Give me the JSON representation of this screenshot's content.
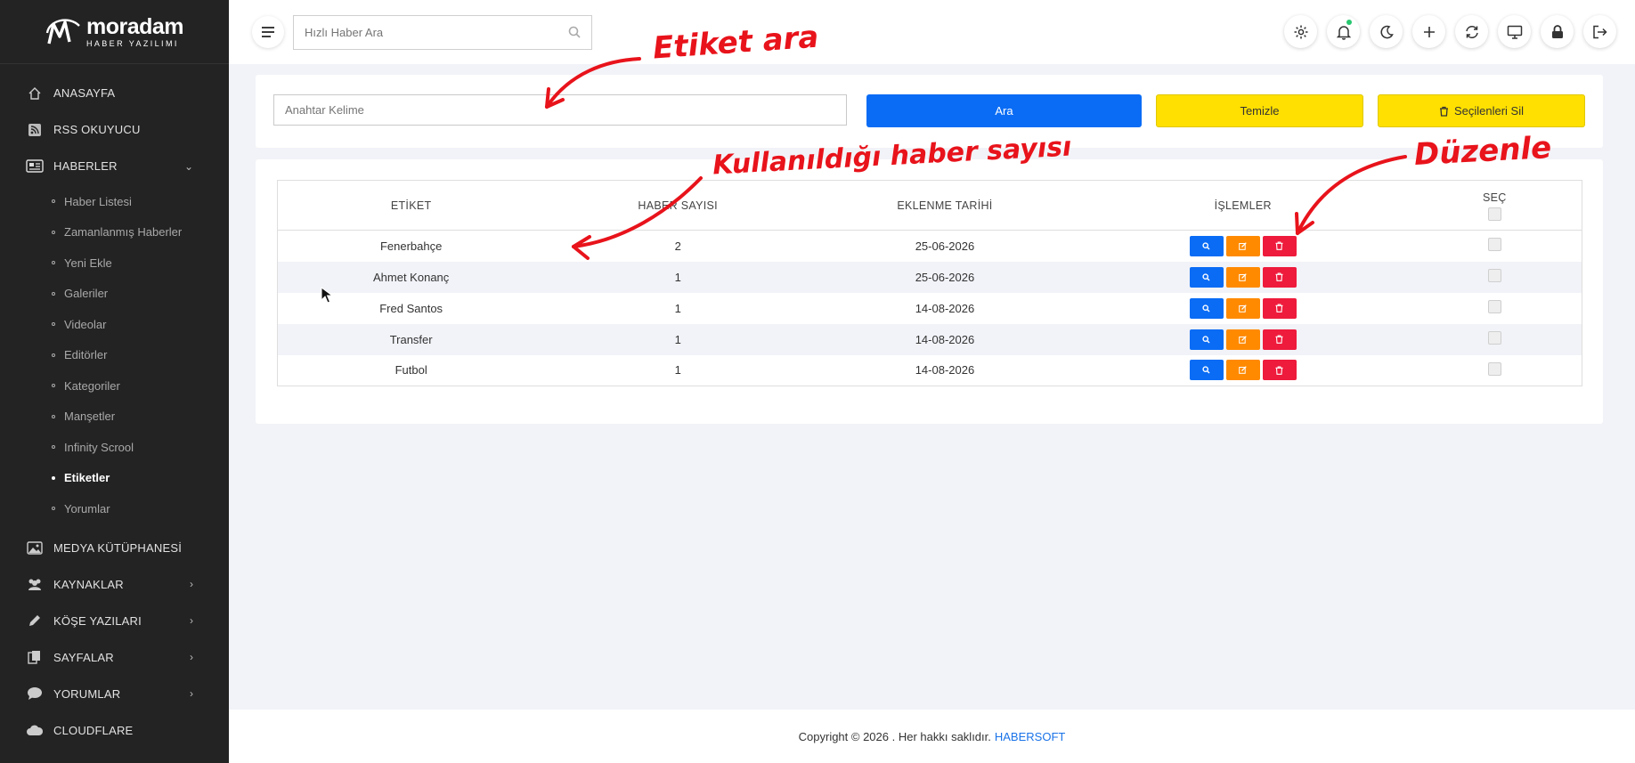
{
  "brand": {
    "name": "moradam",
    "subtitle": "HABER YAZILIMI"
  },
  "sidebar": {
    "items": [
      {
        "label": "ANASAYFA",
        "icon": "home-icon",
        "chevron": false
      },
      {
        "label": "RSS OKUYUCU",
        "icon": "rss-icon",
        "chevron": false
      },
      {
        "label": "HABERLER",
        "icon": "newspaper-icon",
        "chevron": "down",
        "children": [
          {
            "label": "Haber Listesi"
          },
          {
            "label": "Zamanlanmış Haberler"
          },
          {
            "label": "Yeni Ekle"
          },
          {
            "label": "Galeriler"
          },
          {
            "label": "Videolar"
          },
          {
            "label": "Editörler"
          },
          {
            "label": "Kategoriler"
          },
          {
            "label": "Manşetler"
          },
          {
            "label": "Infinity Scrool"
          },
          {
            "label": "Etiketler",
            "active": true
          },
          {
            "label": "Yorumlar"
          }
        ]
      },
      {
        "label": "MEDYA KÜTÜPHANESİ",
        "icon": "image-icon",
        "chevron": false
      },
      {
        "label": "KAYNAKLAR",
        "icon": "users-icon",
        "chevron": "right"
      },
      {
        "label": "KÖŞE YAZILARI",
        "icon": "pen-icon",
        "chevron": "right"
      },
      {
        "label": "SAYFALAR",
        "icon": "pages-icon",
        "chevron": "right"
      },
      {
        "label": "YORUMLAR",
        "icon": "comment-icon",
        "chevron": "right"
      },
      {
        "label": "CLOUDFLARE",
        "icon": "cloud-icon",
        "chevron": false
      }
    ]
  },
  "topbar": {
    "search_placeholder": "Hızlı Haber Ara",
    "icons": [
      "settings-icon",
      "bell-icon",
      "moon-icon",
      "plus-icon",
      "refresh-icon",
      "monitor-icon",
      "lock-icon",
      "logout-icon"
    ]
  },
  "search": {
    "keyword_placeholder": "Anahtar Kelime",
    "search_label": "Ara",
    "clear_label": "Temizle",
    "delete_selected_label": "Seçilenleri Sil"
  },
  "table": {
    "headers": {
      "tag": "ETİKET",
      "count": "HABER SAYISI",
      "date": "EKLENME TARİHİ",
      "actions": "İŞLEMLER",
      "select": "SEÇ"
    },
    "rows": [
      {
        "tag": "Fenerbahçe",
        "count": "2",
        "date": "25-06-2026"
      },
      {
        "tag": "Ahmet Konanç",
        "count": "1",
        "date": "25-06-2026"
      },
      {
        "tag": "Fred Santos",
        "count": "1",
        "date": "14-08-2026"
      },
      {
        "tag": "Transfer",
        "count": "1",
        "date": "14-08-2026"
      },
      {
        "tag": "Futbol",
        "count": "1",
        "date": "14-08-2026"
      }
    ]
  },
  "annotations": {
    "search": "Etiket ara",
    "count": "Kullanıldığı haber sayısı",
    "edit": "Düzenle"
  },
  "footer": {
    "text": "Copyright © 2026 . Her hakkı saklıdır.",
    "brand": "HABERSOFT"
  },
  "colors": {
    "primary": "#0a6cf5",
    "warning": "#ffe000",
    "orange": "#ff8a00",
    "danger": "#ee1b3c",
    "annotation": "#e8131b",
    "sidebar": "#232323"
  }
}
